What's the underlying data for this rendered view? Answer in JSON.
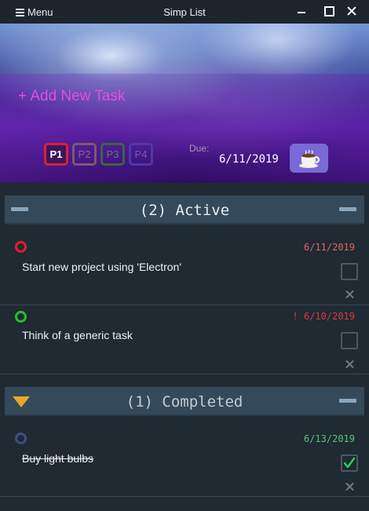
{
  "window": {
    "title": "Simp List",
    "menu_label": "Menu"
  },
  "add_task": {
    "label": "+ Add New Task"
  },
  "priorities": [
    {
      "label": "P1",
      "selected": true
    },
    {
      "label": "P2",
      "selected": false
    },
    {
      "label": "P3",
      "selected": false
    },
    {
      "label": "P4",
      "selected": false
    }
  ],
  "due": {
    "label": "Due:",
    "value": "6/11/2019"
  },
  "sections": {
    "active": {
      "title": "(2) Active",
      "tasks": [
        {
          "text": "Start new project using 'Electron'",
          "date": "6/11/2019",
          "priority_color": "#e01d34",
          "date_color": "#e0645e",
          "checked": false
        },
        {
          "text": "Think of a generic task",
          "date": "! 6/10/2019",
          "priority_color": "#2fb832",
          "date_color": "#e0383e",
          "checked": false
        }
      ]
    },
    "completed": {
      "title": "(1) Completed",
      "tasks": [
        {
          "text": "Buy light bulbs",
          "date": "6/13/2019",
          "priority_color": "#3e4f80",
          "date_color": "#5cc471",
          "checked": true
        }
      ]
    }
  },
  "colors": {
    "accent": "#e24de8",
    "background": "#1f2a33",
    "section_header": "#34495a",
    "coffee_button": "#7a6ad6"
  },
  "icons": {
    "menu": "hamburger-icon",
    "coffee": "coffee-cup-icon",
    "collapse": "minus-icon",
    "expand": "triangle-down-icon",
    "delete": "close-icon",
    "check": "checkmark-icon"
  }
}
